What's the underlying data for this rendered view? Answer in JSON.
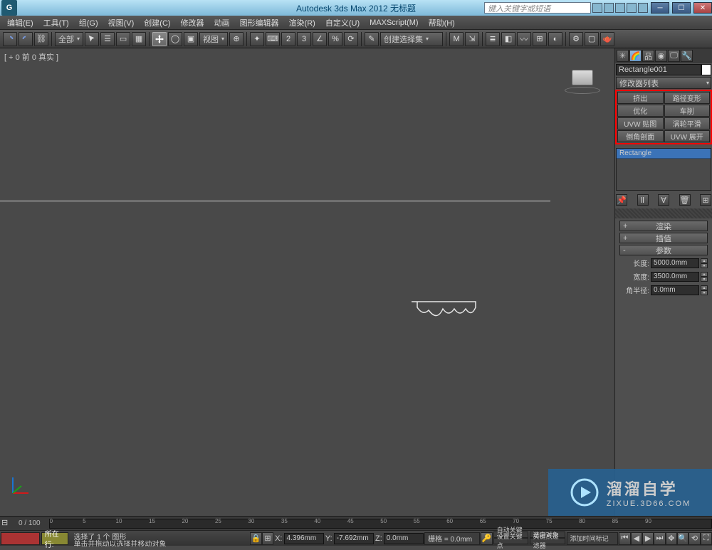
{
  "title": "Autodesk 3ds Max 2012    无标题",
  "search_placeholder": "键入关键字或短语",
  "menu": [
    "编辑(E)",
    "工具(T)",
    "组(G)",
    "视图(V)",
    "创建(C)",
    "修改器",
    "动画",
    "图形编辑器",
    "渲染(R)",
    "自定义(U)",
    "MAXScript(M)",
    "帮助(H)"
  ],
  "toolbar": {
    "all_label": "全部",
    "view_label": "视图",
    "selset_label": "创建选择集"
  },
  "viewport_label": "[ + 0 前 0 真实 ]",
  "right_panel": {
    "object_name": "Rectangle001",
    "modifier_list_label": "修改器列表",
    "mod_buttons": [
      "挤出",
      "路径变形",
      "优化",
      "车削",
      "UVW 贴图",
      "涡轮平滑",
      "倒角剖面",
      "UVW 展开"
    ],
    "stack_item": "Rectangle",
    "rollouts": [
      {
        "sign": "+",
        "label": "渲染"
      },
      {
        "sign": "+",
        "label": "插值"
      },
      {
        "sign": "-",
        "label": "参数"
      }
    ],
    "params": [
      {
        "label": "长度:",
        "value": "5000.0mm"
      },
      {
        "label": "宽度:",
        "value": "3500.0mm"
      },
      {
        "label": "角半径:",
        "value": "0.0mm"
      }
    ]
  },
  "timeline": {
    "range": "0 / 100",
    "ticks": [
      "0",
      "5",
      "10",
      "15",
      "20",
      "25",
      "30",
      "35",
      "40",
      "45",
      "50",
      "55",
      "60",
      "65",
      "70",
      "75",
      "80",
      "85",
      "90"
    ]
  },
  "status": {
    "line1": "选择了 1 个 图形",
    "line2": "单击并拖动以选择并移动对象",
    "x_lbl": "X:",
    "x": "4.396mm",
    "y_lbl": "Y:",
    "y": "-7.692mm",
    "z_lbl": "Z:",
    "z": "0.0mm",
    "grid_label": "栅格 = 0.0mm",
    "autokey": "自动关键点",
    "selset2": "选定对象",
    "setkey": "设置关键点",
    "keyfilter": "关键点过滤器",
    "addtime": "添加时间标记",
    "row_label": "所在行:"
  },
  "watermark": {
    "cn": "溜溜自学",
    "en": "ZIXUE.3D66.COM"
  }
}
